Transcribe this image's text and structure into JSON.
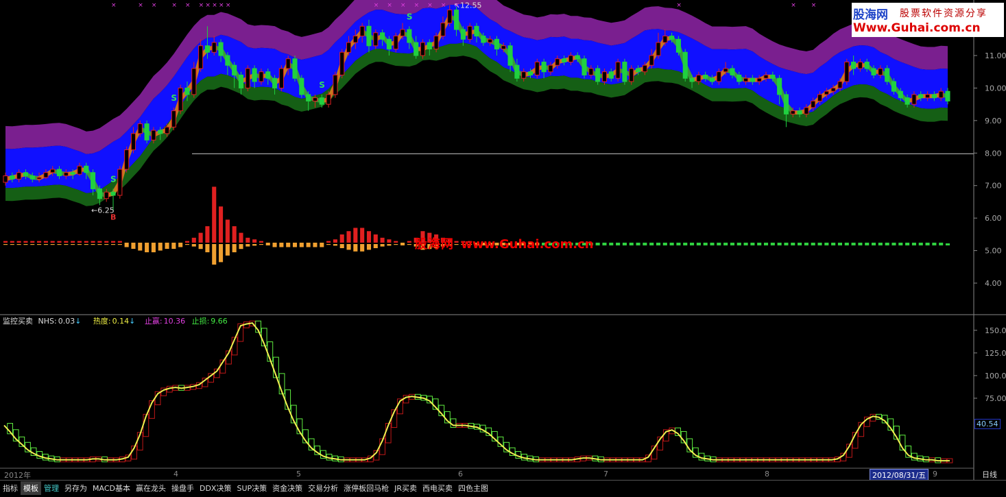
{
  "chart_data": {
    "type": "candlestick",
    "price_axis_ticks": [
      "11.00",
      "10.00",
      "9.00",
      "8.00",
      "7.00",
      "6.00",
      "5.00",
      "4.00"
    ],
    "price_ylim": [
      3.6,
      12.8
    ],
    "annotations": {
      "high_label": "12.55",
      "low_label": "6.25",
      "signal_glyph_sell": "S",
      "signal_glyph_buy": "B"
    },
    "candles": [
      [
        7.1,
        7.3,
        7.0,
        7.4
      ],
      [
        7.3,
        7.2,
        7.1,
        7.4
      ],
      [
        7.2,
        7.4,
        7.1,
        7.5
      ],
      [
        7.4,
        7.3,
        7.2,
        7.5
      ],
      [
        7.3,
        7.2,
        7.1,
        7.4
      ],
      [
        7.2,
        7.25,
        7.1,
        7.4
      ],
      [
        7.25,
        7.4,
        7.2,
        7.5
      ],
      [
        7.4,
        7.5,
        7.3,
        7.6
      ],
      [
        7.5,
        7.3,
        7.2,
        7.6
      ],
      [
        7.3,
        7.4,
        7.2,
        7.5
      ],
      [
        7.4,
        7.35,
        7.2,
        7.5
      ],
      [
        7.35,
        7.6,
        7.3,
        7.7
      ],
      [
        7.6,
        7.4,
        7.2,
        7.7
      ],
      [
        7.4,
        6.9,
        6.7,
        7.5
      ],
      [
        6.9,
        6.6,
        6.4,
        7.0
      ],
      [
        6.6,
        6.8,
        6.5,
        6.9
      ],
      [
        6.8,
        6.7,
        6.25,
        6.9
      ],
      [
        6.7,
        7.5,
        6.6,
        7.6
      ],
      [
        7.5,
        8.1,
        7.4,
        8.2
      ],
      [
        8.1,
        8.6,
        8.0,
        8.8
      ],
      [
        8.6,
        8.9,
        8.5,
        9.0
      ],
      [
        8.9,
        8.4,
        8.3,
        9.0
      ],
      [
        8.4,
        8.7,
        8.3,
        8.8
      ],
      [
        8.7,
        8.6,
        8.4,
        8.8
      ],
      [
        8.6,
        8.8,
        8.5,
        8.9
      ],
      [
        8.8,
        9.3,
        8.7,
        9.4
      ],
      [
        9.3,
        10.0,
        9.2,
        10.1
      ],
      [
        10.0,
        9.8,
        9.6,
        10.2
      ],
      [
        9.8,
        10.6,
        9.7,
        10.8
      ],
      [
        10.6,
        11.3,
        10.5,
        11.5
      ],
      [
        11.3,
        11.1,
        10.9,
        11.9
      ],
      [
        11.1,
        11.4,
        11.0,
        11.6
      ],
      [
        11.4,
        11.0,
        10.8,
        11.5
      ],
      [
        11.0,
        10.7,
        10.4,
        11.1
      ],
      [
        10.7,
        10.4,
        10.0,
        10.8
      ],
      [
        10.4,
        10.0,
        9.8,
        10.5
      ],
      [
        10.0,
        10.6,
        9.9,
        10.7
      ],
      [
        10.6,
        10.2,
        10.0,
        10.7
      ],
      [
        10.2,
        10.5,
        10.1,
        10.6
      ],
      [
        10.5,
        10.3,
        10.1,
        10.6
      ],
      [
        10.3,
        10.0,
        9.8,
        10.4
      ],
      [
        10.0,
        10.6,
        9.9,
        10.7
      ],
      [
        10.6,
        10.9,
        10.4,
        11.0
      ],
      [
        10.9,
        10.3,
        10.2,
        11.0
      ],
      [
        10.3,
        9.8,
        9.7,
        10.4
      ],
      [
        9.8,
        9.6,
        9.3,
        9.9
      ],
      [
        9.6,
        9.7,
        9.4,
        9.8
      ],
      [
        9.7,
        9.5,
        9.4,
        9.8
      ],
      [
        9.5,
        9.8,
        9.4,
        9.9
      ],
      [
        9.8,
        10.4,
        9.7,
        10.5
      ],
      [
        10.4,
        11.1,
        10.3,
        11.2
      ],
      [
        11.1,
        11.4,
        11.0,
        11.6
      ],
      [
        11.4,
        11.6,
        11.2,
        11.8
      ],
      [
        11.6,
        11.9,
        11.4,
        12.0
      ],
      [
        11.9,
        11.3,
        11.1,
        12.1
      ],
      [
        11.3,
        11.7,
        11.2,
        11.8
      ],
      [
        11.7,
        11.5,
        11.3,
        11.8
      ],
      [
        11.5,
        11.2,
        11.0,
        11.6
      ],
      [
        11.2,
        11.6,
        11.1,
        11.7
      ],
      [
        11.6,
        11.8,
        11.5,
        12.0
      ],
      [
        11.8,
        11.4,
        11.2,
        11.9
      ],
      [
        11.4,
        11.0,
        10.9,
        11.6
      ],
      [
        11.0,
        11.4,
        10.9,
        11.5
      ],
      [
        11.4,
        11.2,
        11.0,
        11.5
      ],
      [
        11.2,
        11.6,
        11.1,
        11.7
      ],
      [
        11.6,
        12.0,
        11.5,
        12.2
      ],
      [
        12.0,
        12.4,
        11.9,
        12.55
      ],
      [
        12.4,
        11.8,
        11.6,
        12.5
      ],
      [
        11.8,
        11.5,
        11.3,
        11.9
      ],
      [
        11.5,
        11.9,
        11.4,
        12.0
      ],
      [
        11.9,
        11.6,
        11.4,
        12.0
      ],
      [
        11.6,
        11.4,
        11.3,
        11.7
      ],
      [
        11.4,
        11.5,
        11.3,
        11.6
      ],
      [
        11.5,
        11.2,
        11.0,
        11.6
      ],
      [
        11.2,
        11.3,
        11.1,
        11.4
      ],
      [
        11.3,
        10.7,
        10.5,
        11.4
      ],
      [
        10.7,
        10.3,
        10.2,
        10.9
      ],
      [
        10.3,
        10.5,
        10.2,
        10.6
      ],
      [
        10.5,
        10.4,
        10.3,
        10.6
      ],
      [
        10.4,
        10.8,
        10.3,
        10.9
      ],
      [
        10.8,
        10.5,
        10.3,
        10.9
      ],
      [
        10.5,
        10.7,
        10.4,
        10.8
      ],
      [
        10.7,
        10.9,
        10.6,
        11.0
      ],
      [
        10.9,
        10.8,
        10.7,
        11.0
      ],
      [
        10.8,
        11.0,
        10.7,
        11.1
      ],
      [
        11.0,
        10.9,
        10.8,
        11.1
      ],
      [
        10.9,
        10.4,
        10.3,
        11.0
      ],
      [
        10.4,
        10.6,
        10.3,
        10.7
      ],
      [
        10.6,
        10.2,
        10.1,
        10.7
      ],
      [
        10.2,
        10.5,
        10.1,
        10.6
      ],
      [
        10.5,
        10.3,
        10.2,
        10.6
      ],
      [
        10.3,
        10.8,
        10.2,
        10.9
      ],
      [
        10.8,
        10.2,
        10.1,
        10.9
      ],
      [
        10.2,
        10.6,
        10.1,
        10.7
      ],
      [
        10.6,
        10.5,
        10.4,
        10.7
      ],
      [
        10.5,
        10.7,
        10.4,
        10.8
      ],
      [
        10.7,
        11.0,
        10.6,
        11.2
      ],
      [
        11.0,
        11.4,
        10.9,
        11.7
      ],
      [
        11.4,
        11.6,
        11.3,
        11.8
      ],
      [
        11.6,
        11.5,
        11.4,
        11.7
      ],
      [
        11.5,
        11.1,
        11.0,
        11.6
      ],
      [
        11.1,
        10.3,
        10.2,
        11.2
      ],
      [
        10.3,
        10.2,
        10.0,
        10.4
      ],
      [
        10.2,
        10.4,
        10.1,
        10.5
      ],
      [
        10.4,
        10.3,
        10.2,
        10.5
      ],
      [
        10.3,
        10.2,
        10.1,
        10.4
      ],
      [
        10.2,
        10.5,
        10.1,
        10.6
      ],
      [
        10.5,
        10.6,
        10.4,
        10.8
      ],
      [
        10.6,
        10.4,
        10.3,
        10.7
      ],
      [
        10.4,
        10.2,
        10.1,
        10.5
      ],
      [
        10.2,
        10.3,
        10.1,
        10.4
      ],
      [
        10.3,
        10.2,
        10.1,
        10.4
      ],
      [
        10.2,
        10.3,
        10.1,
        10.4
      ],
      [
        10.3,
        10.4,
        10.2,
        10.5
      ],
      [
        10.4,
        10.3,
        10.2,
        10.5
      ],
      [
        10.3,
        9.8,
        9.5,
        10.4
      ],
      [
        9.8,
        9.2,
        8.8,
        9.9
      ],
      [
        9.2,
        9.3,
        9.1,
        9.4
      ],
      [
        9.3,
        9.2,
        9.1,
        9.4
      ],
      [
        9.2,
        9.4,
        9.1,
        9.5
      ],
      [
        9.4,
        9.6,
        9.3,
        9.7
      ],
      [
        9.6,
        9.8,
        9.5,
        9.9
      ],
      [
        9.8,
        9.9,
        9.7,
        10.0
      ],
      [
        9.9,
        10.0,
        9.8,
        10.1
      ],
      [
        10.0,
        10.2,
        9.9,
        10.3
      ],
      [
        10.2,
        10.8,
        10.1,
        10.9
      ],
      [
        10.8,
        10.6,
        10.4,
        11.0
      ],
      [
        10.6,
        10.8,
        10.5,
        10.9
      ],
      [
        10.8,
        10.6,
        10.5,
        10.9
      ],
      [
        10.6,
        10.4,
        10.3,
        10.7
      ],
      [
        10.4,
        10.6,
        10.3,
        10.7
      ],
      [
        10.6,
        10.2,
        10.1,
        10.7
      ],
      [
        10.2,
        9.9,
        9.8,
        10.3
      ],
      [
        9.9,
        9.7,
        9.6,
        10.0
      ],
      [
        9.7,
        9.5,
        9.4,
        9.8
      ],
      [
        9.5,
        9.8,
        9.4,
        9.9
      ],
      [
        9.8,
        9.7,
        9.6,
        9.9
      ],
      [
        9.7,
        9.8,
        9.6,
        9.9
      ],
      [
        9.8,
        9.7,
        9.6,
        9.9
      ],
      [
        9.7,
        9.9,
        9.6,
        10.0
      ],
      [
        9.9,
        9.6,
        9.5,
        10.0
      ]
    ],
    "momentum_bars": [
      0.05,
      0.05,
      0.05,
      0.05,
      0.05,
      0.05,
      0.05,
      0.05,
      0.05,
      0.05,
      0.05,
      0.05,
      0.05,
      0.05,
      0.05,
      0.05,
      0.05,
      0.05,
      -0.05,
      -0.1,
      -0.15,
      -0.2,
      -0.2,
      -0.15,
      -0.1,
      -0.1,
      -0.05,
      0.05,
      0.15,
      0.3,
      0.5,
      1.7,
      1.1,
      0.7,
      0.5,
      0.3,
      0.15,
      0.1,
      0.05,
      0.0,
      -0.05,
      -0.05,
      -0.05,
      -0.05,
      -0.05,
      -0.05,
      -0.05,
      -0.05,
      0.05,
      0.1,
      0.25,
      0.35,
      0.45,
      0.45,
      0.35,
      0.25,
      0.15,
      0.1,
      0.05,
      0.0,
      0.05,
      0.15,
      0.35,
      0.3,
      0.25,
      0.15,
      0.1,
      0.05,
      0.05,
      0.05,
      0.0,
      0.0,
      0.0,
      0.0,
      0.0,
      0.0,
      0.0,
      0.0,
      0.0,
      0.0,
      0.0,
      0.0,
      0.0,
      0.0,
      0.0,
      0.0,
      0.0,
      0.0,
      0.0,
      0.0,
      0.0,
      0.0,
      0.0,
      0.0,
      0.0,
      0.0,
      0.0,
      0.0,
      0.0,
      0.0,
      0.0,
      0.0,
      0.0,
      0.0,
      0.0,
      0.0,
      0.0,
      0.0,
      0.0,
      0.0,
      0.0,
      0.0,
      0.0,
      0.0,
      0.0,
      0.0,
      0.0,
      0.0,
      0.0,
      0.0,
      0.0,
      0.0,
      0.0,
      0.0,
      0.0,
      0.0,
      0.0,
      0.0,
      0.0,
      0.0,
      0.0,
      0.0,
      0.0,
      0.0,
      0.0,
      0.0,
      0.0,
      0.0,
      0.0,
      0.0
    ],
    "lower_axis_ticks": [
      "150.00",
      "125.00",
      "100.00",
      "75.00"
    ],
    "lower_ylim": [
      0,
      165
    ],
    "lower_current_value": "40.54",
    "lower_series": [
      45,
      38,
      30,
      24,
      18,
      14,
      11,
      9,
      8,
      7,
      7,
      7,
      7,
      7,
      7,
      8,
      8,
      7,
      7,
      7,
      8,
      10,
      20,
      35,
      55,
      70,
      80,
      84,
      86,
      87,
      86,
      87,
      88,
      90,
      95,
      100,
      105,
      115,
      125,
      140,
      155,
      157,
      158,
      150,
      135,
      118,
      100,
      82,
      65,
      50,
      38,
      28,
      20,
      15,
      11,
      9,
      8,
      7,
      7,
      7,
      7,
      7,
      9,
      15,
      28,
      45,
      60,
      72,
      76,
      77,
      76,
      75,
      72,
      65,
      58,
      50,
      45,
      45,
      45,
      44,
      43,
      40,
      36,
      30,
      24,
      18,
      14,
      11,
      9,
      8,
      7,
      7,
      7,
      7,
      7,
      7,
      7,
      8,
      9,
      9,
      8,
      7,
      7,
      7,
      7,
      7,
      7,
      7,
      7,
      10,
      20,
      30,
      38,
      40,
      36,
      28,
      18,
      12,
      9,
      8,
      7,
      7,
      7,
      7,
      7,
      7,
      7,
      7,
      7,
      7,
      7,
      7,
      7,
      7,
      7,
      7,
      7,
      7,
      7,
      7,
      7,
      8,
      12,
      22,
      35,
      46,
      52,
      55,
      54,
      50,
      42,
      32,
      20,
      12,
      9,
      8,
      7,
      7,
      6,
      6,
      6
    ]
  },
  "date_axis": [
    "2012年",
    "4",
    "5",
    "6",
    "7",
    "8",
    "9"
  ],
  "current_date": "2012/08/31/五",
  "period_label": "日线",
  "indicator_header": {
    "name": "监控买卖",
    "nhs_label": "NHS:",
    "nhs_value": "0.03",
    "nhs_arrow": "↓",
    "heat_label": "热度:",
    "heat_value": "0.14",
    "heat_arrow": "↓",
    "tp_label": "止赢:",
    "tp_value": "10.36",
    "sl_label": "止损:",
    "sl_value": "9.66"
  },
  "logo": {
    "name": "股海网",
    "slogan": "股票软件资源分享",
    "url": "Www.Guhai.com.cn"
  },
  "watermark": {
    "name": "股海网",
    "url": "www.Guhai.com.cn"
  },
  "tabs": [
    {
      "label": "指标"
    },
    {
      "label": "模板",
      "active": true
    },
    {
      "label": "管理",
      "alt": true
    },
    {
      "label": "另存为"
    },
    {
      "label": "MACD基本"
    },
    {
      "label": "赢在龙头"
    },
    {
      "label": "操盘手"
    },
    {
      "label": "DDX决策"
    },
    {
      "label": "SUP决策"
    },
    {
      "label": "资金决策"
    },
    {
      "label": "交易分析"
    },
    {
      "label": "涨停板回马枪"
    },
    {
      "label": "JR买卖"
    },
    {
      "label": "西电买卖"
    },
    {
      "label": "四色主图"
    }
  ],
  "colors": {
    "up": "#e02020",
    "down": "#20d040",
    "band_purple": "#7a1f8f",
    "band_blue": "#1010ff",
    "band_navy": "#1010a0",
    "band_green": "#155f15",
    "trend_orange": "#c87820",
    "trend_green": "#3a9a3a",
    "bar_pos": "#e02020",
    "bar_neg": "#f0a030",
    "dot": "#30d040",
    "curve": "#f0f050",
    "step_red": "#c01818",
    "step_green": "#60ee40"
  }
}
